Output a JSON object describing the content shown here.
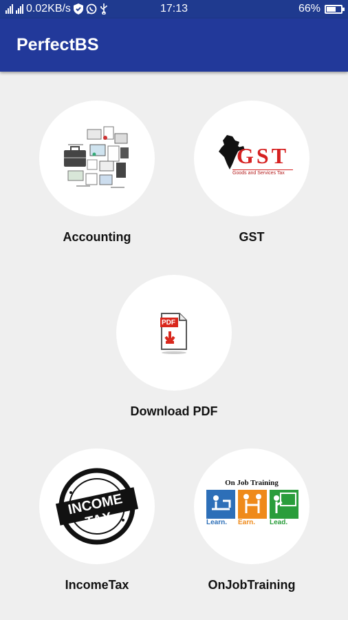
{
  "status_bar": {
    "network_speed": "0.02KB/s",
    "time": "17:13",
    "battery": "66%",
    "battery_level": 0.66
  },
  "app_bar": {
    "title": "PerfectBS"
  },
  "menu": {
    "accounting": {
      "label": "Accounting",
      "icon": "accounting-collage-icon"
    },
    "gst": {
      "label": "GST",
      "icon": "gst-india-map-icon",
      "logo_text": "GST",
      "logo_subtext": "Goods and Services Tax"
    },
    "download_pdf": {
      "label": "Download PDF",
      "icon": "pdf-download-icon",
      "badge": "PDF"
    },
    "income_tax": {
      "label": "IncomeTax",
      "icon": "income-tax-stamp-icon",
      "stamp_text": "INCOME TAX"
    },
    "on_job_training": {
      "label": "OnJobTraining",
      "icon": "on-job-training-icon",
      "heading": "On Job Training",
      "steps": [
        "Learn.",
        "Earn.",
        "Lead."
      ],
      "step_colors": [
        "#2d6fb8",
        "#ef8a1a",
        "#2a9d3b"
      ]
    }
  }
}
